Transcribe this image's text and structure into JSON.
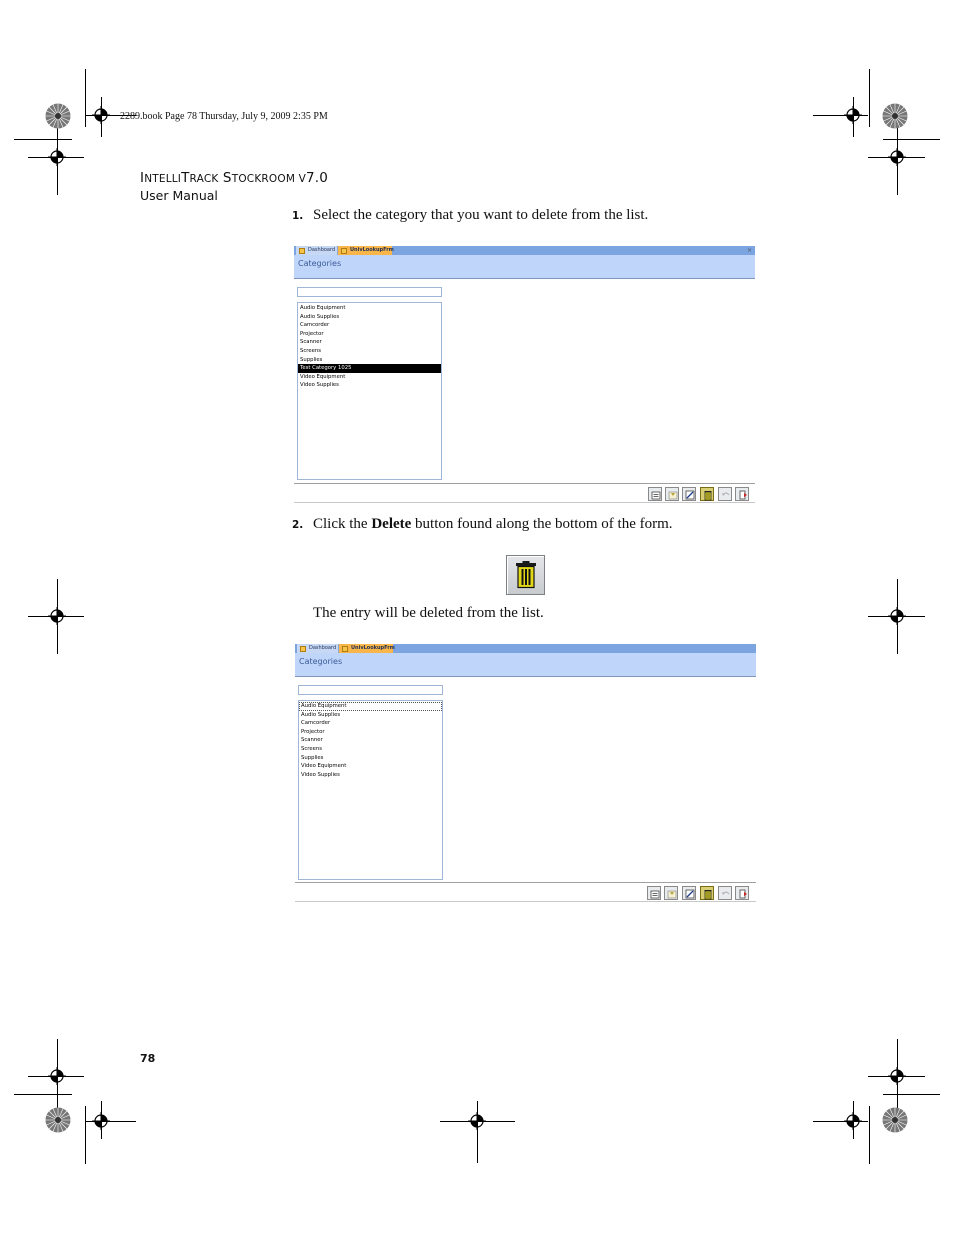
{
  "file_stamp": "2289.book  Page 78  Thursday, July 9, 2009  2:35 PM",
  "header": {
    "title_parts": [
      "I",
      "NTELLI",
      "T",
      "RACK",
      " S",
      "TOCKROOM",
      " V",
      "7.0"
    ],
    "subtitle": "User Manual"
  },
  "steps": [
    {
      "number": "1.",
      "text": "Select the category that you want to delete from the list."
    },
    {
      "number": "2.",
      "text_before": "Click the ",
      "bold": "Delete",
      "text_after": " button found along the bottom of the form."
    }
  ],
  "result_text": "The entry will be deleted from the list.",
  "page_number": "78",
  "form_before": {
    "tabs": [
      "Dashboard",
      "UnivLookupFrm"
    ],
    "close_glyph": "×",
    "title": "Categories",
    "items": [
      "Audio Equipment",
      "Audio Supplies",
      "Camcorder",
      "Projector",
      "Scanner",
      "Screens",
      "Supplies",
      "Test Category 1025",
      "Video Equipment",
      "Video Supplies"
    ],
    "selected_item": "Test Category 1025"
  },
  "form_after": {
    "tabs": [
      "Dashboard",
      "UnivLookupFrm"
    ],
    "title": "Categories",
    "items": [
      "Audio Equipment",
      "Audio Supplies",
      "Camcorder",
      "Projector",
      "Scanner",
      "Screens",
      "Supplies",
      "Video Equipment",
      "Video Supplies"
    ],
    "focused_item": "Audio Equipment"
  },
  "toolbar_icons": [
    "new-record-icon",
    "save-record-icon",
    "edit-record-icon",
    "delete-trash-icon",
    "undo-icon",
    "exit-icon"
  ],
  "colors": {
    "tab_bar": "#7ba4e0",
    "active_tab": "#f8b54a",
    "title_bar": "#bfd5fa",
    "title_text": "#3a5c98",
    "trash_yellow": "#d8cf18"
  }
}
